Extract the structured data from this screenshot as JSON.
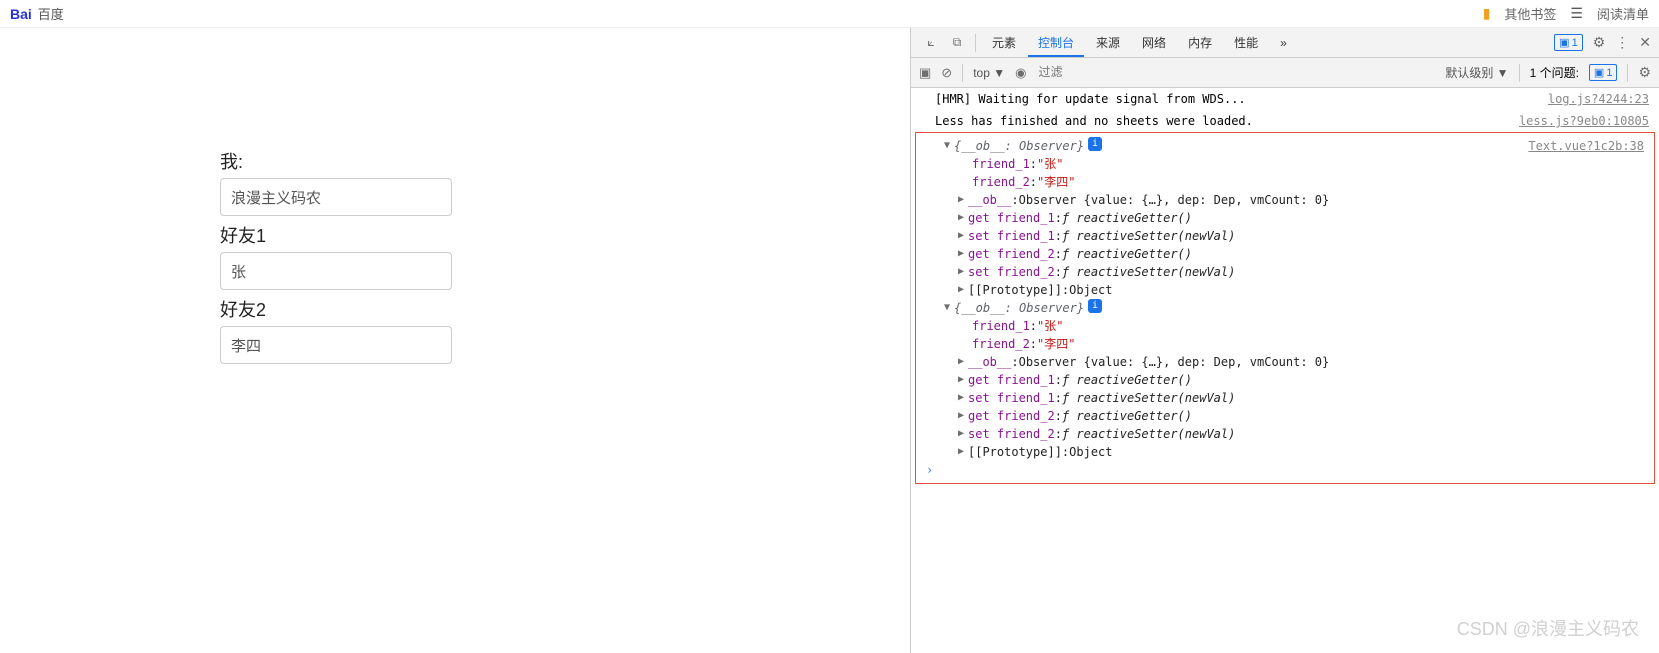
{
  "topbar": {
    "brand": "百度",
    "bookmarks": "其他书签",
    "readlist": "阅读清单"
  },
  "form": {
    "label_me": "我:",
    "value_me": "浪漫主义码农",
    "label_f1": "好友1",
    "value_f1": "张",
    "label_f2": "好友2",
    "value_f2": "李四"
  },
  "devtools": {
    "tabs": {
      "elements": "元素",
      "console": "控制台",
      "sources": "来源",
      "network": "网络",
      "memory": "内存",
      "performance": "性能",
      "more": "»"
    },
    "msg_count": "1",
    "toolbar": {
      "top": "top ▼",
      "filter_ph": "过滤",
      "level": "默认级别 ▼",
      "issues": "1 个问题:"
    }
  },
  "console": {
    "hmr": "[HMR] Waiting for update signal from WDS...",
    "hmr_src": "log.js?4244:23",
    "less": "Less has finished and no sheets were loaded.",
    "less_src": "less.js?9eb0:10805",
    "obj_src": "Text.vue?1c2b:38",
    "obj_head": "{__ob__: Observer}",
    "friend1_k": "friend_1",
    "friend1_v": "\"张\"",
    "friend2_k": "friend_2",
    "friend2_v": "\"李四\"",
    "ob_k": "__ob__",
    "ob_v": "Observer {value: {…}, dep: Dep, vmCount: 0}",
    "get_f1": "get friend_1",
    "getter": "reactiveGetter()",
    "set_f1": "set friend_1",
    "setter": "reactiveSetter(newVal)",
    "get_f2": "get friend_2",
    "set_f2": "set friend_2",
    "proto_k": "[[Prototype]]",
    "proto_v": "Object",
    "f_sym": "ƒ"
  },
  "watermark": "CSDN @浪漫主义码农"
}
